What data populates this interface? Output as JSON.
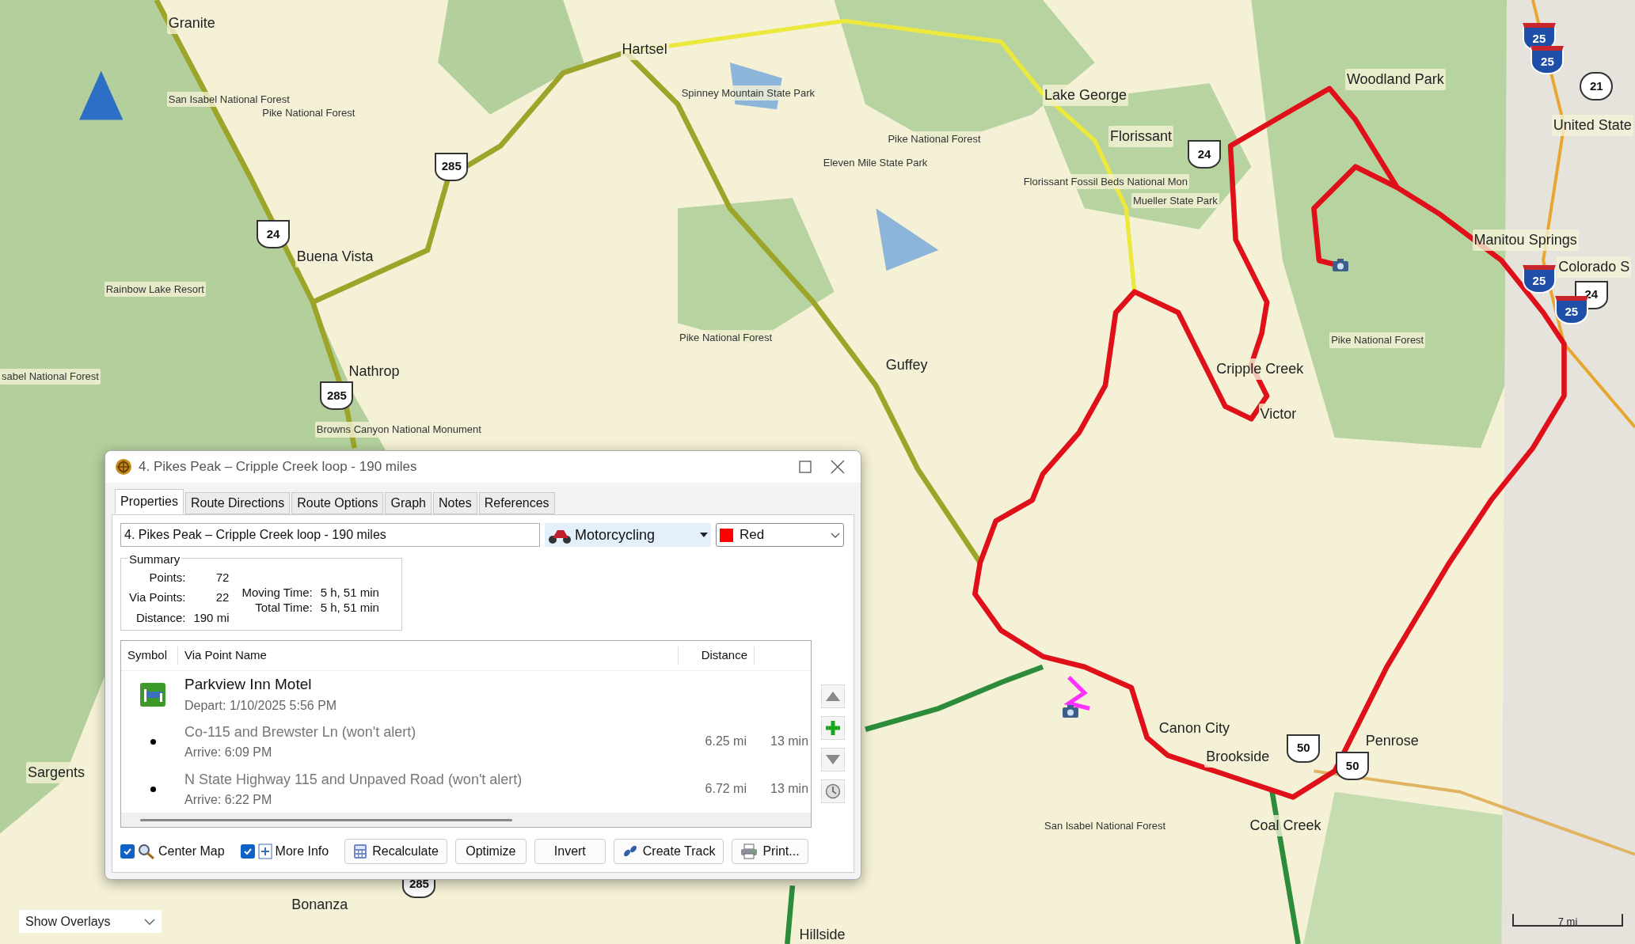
{
  "map": {
    "places": [
      {
        "name": "Granite",
        "kind": "town"
      },
      {
        "name": "Hartsel",
        "kind": "town"
      },
      {
        "name": "Lake George",
        "kind": "town"
      },
      {
        "name": "Woodland Park",
        "kind": "town"
      },
      {
        "name": "San Isabel National Forest",
        "kind": "area"
      },
      {
        "name": "Pike National Forest",
        "kind": "area"
      },
      {
        "name": "Spinney Mountain State Park",
        "kind": "area"
      },
      {
        "name": "Pike National Forest",
        "kind": "area"
      },
      {
        "name": "Eleven Mile State Park",
        "kind": "area"
      },
      {
        "name": "Florissant",
        "kind": "town"
      },
      {
        "name": "Florissant Fossil Beds National Mon",
        "kind": "area"
      },
      {
        "name": "Mueller State Park",
        "kind": "area"
      },
      {
        "name": "Buena Vista",
        "kind": "town"
      },
      {
        "name": "Rainbow Lake Resort",
        "kind": "area"
      },
      {
        "name": "Manitou Springs",
        "kind": "town"
      },
      {
        "name": "Colorado S",
        "kind": "town"
      },
      {
        "name": "United State",
        "kind": "town"
      },
      {
        "name": "Pike National Forest",
        "kind": "area"
      },
      {
        "name": "Pike National Forest",
        "kind": "area"
      },
      {
        "name": "Guffey",
        "kind": "town"
      },
      {
        "name": "Nathrop",
        "kind": "town"
      },
      {
        "name": "Browns Canyon National Monument",
        "kind": "area"
      },
      {
        "name": "Cripple Creek",
        "kind": "town"
      },
      {
        "name": "Victor",
        "kind": "town"
      },
      {
        "name": "sabel National Forest",
        "kind": "area"
      },
      {
        "name": "Canon City",
        "kind": "town"
      },
      {
        "name": "Brookside",
        "kind": "town"
      },
      {
        "name": "Penrose",
        "kind": "town"
      },
      {
        "name": "Coal Creek",
        "kind": "town"
      },
      {
        "name": "San Isabel National Forest",
        "kind": "area"
      },
      {
        "name": "Sargents",
        "kind": "town"
      },
      {
        "name": "Bonanza",
        "kind": "town"
      },
      {
        "name": "Hillside",
        "kind": "town"
      }
    ],
    "shields": [
      {
        "number": "285",
        "kind": "us"
      },
      {
        "number": "285",
        "kind": "us"
      },
      {
        "number": "285",
        "kind": "us"
      },
      {
        "number": "24",
        "kind": "us"
      },
      {
        "number": "24",
        "kind": "us"
      },
      {
        "number": "24",
        "kind": "us"
      },
      {
        "number": "50",
        "kind": "us"
      },
      {
        "number": "50",
        "kind": "us"
      },
      {
        "number": "25",
        "kind": "interstate"
      },
      {
        "number": "25",
        "kind": "interstate"
      },
      {
        "number": "25",
        "kind": "interstate"
      },
      {
        "number": "25",
        "kind": "interstate"
      },
      {
        "number": "21",
        "kind": "state"
      }
    ],
    "overlay_select": {
      "value": "Show Overlays"
    },
    "scale": "7 mi"
  },
  "dialog": {
    "title": "4. Pikes Peak – Cripple Creek loop - 190 miles",
    "tabs": [
      {
        "label": "Properties",
        "selected": true
      },
      {
        "label": "Route Directions",
        "selected": false
      },
      {
        "label": "Route Options",
        "selected": false
      },
      {
        "label": "Graph",
        "selected": false
      },
      {
        "label": "Notes",
        "selected": false
      },
      {
        "label": "References",
        "selected": false
      }
    ],
    "name_field": {
      "value": "4. Pikes Peak – Cripple Creek loop - 190 miles"
    },
    "activity": {
      "value": "Motorcycling"
    },
    "route_color": {
      "value": "Red",
      "color": "#ff0000"
    },
    "summary": {
      "title": "Summary",
      "left": [
        {
          "label": "Points:",
          "value": "72"
        },
        {
          "label": "Via Points:",
          "value": "22"
        },
        {
          "label": "Distance:",
          "value": "190 mi"
        }
      ],
      "right": [
        {
          "label": "Moving Time:",
          "value": "5 h, 51 min"
        },
        {
          "label": "Total Time:",
          "value": "5 h, 51 min"
        }
      ]
    },
    "columns": [
      "Symbol",
      "Via Point Name",
      "Distance"
    ],
    "rows": [
      {
        "kind": "start",
        "name": "Parkview Inn Motel",
        "detail": "Depart: 1/10/2025 5:56 PM"
      },
      {
        "kind": "via",
        "name": "Co-115 and Brewster Ln (won't alert)",
        "detail": "Arrive: 6:09 PM",
        "distance": "6.25 mi",
        "time": "13 min"
      },
      {
        "kind": "via",
        "name": "N State Highway 115 and Unpaved Road (won't alert)",
        "detail": "Arrive: 6:22 PM",
        "distance": "6.72 mi",
        "time": "13 min"
      }
    ],
    "options": [
      {
        "label": "Center Map",
        "checked": true
      },
      {
        "label": "More Info",
        "checked": true
      }
    ],
    "buttons": [
      "Recalculate",
      "Optimize",
      "Invert",
      "Create Track",
      "Print..."
    ]
  }
}
